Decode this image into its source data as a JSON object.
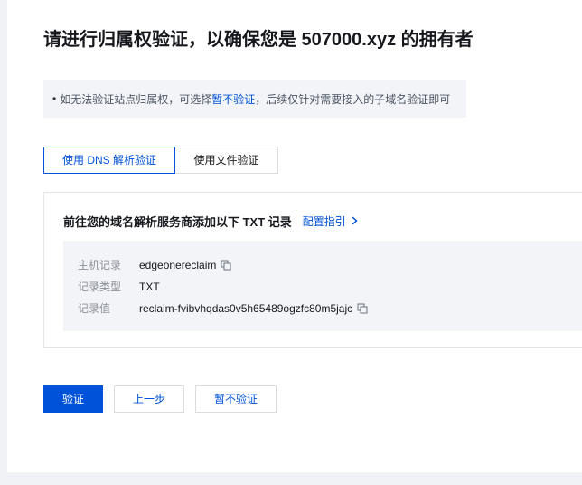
{
  "title": "请进行归属权验证，以确保您是 507000.xyz 的拥有者",
  "notice": {
    "bullet": "•",
    "before": "如无法验证站点归属权，可选择",
    "link": "暂不验证",
    "after": "，后续仅针对需要接入的子域名验证即可"
  },
  "tabs": [
    {
      "label": "使用 DNS 解析验证",
      "active": true
    },
    {
      "label": "使用文件验证",
      "active": false
    }
  ],
  "card": {
    "title": "前往您的域名解析服务商添加以下 TXT 记录",
    "guide_link": "配置指引"
  },
  "records": [
    {
      "label": "主机记录",
      "value": "edgeonereclaim",
      "copyable": true
    },
    {
      "label": "记录类型",
      "value": "TXT",
      "copyable": false
    },
    {
      "label": "记录值",
      "value": "reclaim-fvibvhqdas0v5h65489ogzfc80m5jajc",
      "copyable": true
    }
  ],
  "buttons": {
    "verify": "验证",
    "previous": "上一步",
    "skip": "暂不验证"
  },
  "colors": {
    "accent": "#0052d9",
    "panel_bg": "#ffffff",
    "page_bg": "#f1f2f5",
    "notice_bg": "#f3f4f7"
  },
  "icons": {
    "copy": "copy-icon",
    "chevron": "chevron-right-icon"
  }
}
